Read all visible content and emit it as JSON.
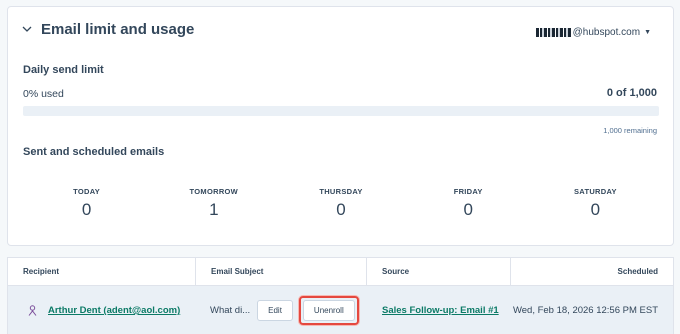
{
  "usage_card": {
    "title": "Email limit and usage",
    "account_suffix": "@hubspot.com",
    "daily_limit_title": "Daily send limit",
    "used_label": "0% used",
    "count_label": "0 of 1,000",
    "used_fraction": 0,
    "remaining_label": "1,000 remaining",
    "sent_title": "Sent and scheduled emails",
    "days": [
      {
        "label": "TODAY",
        "value": "0"
      },
      {
        "label": "TOMORROW",
        "value": "1"
      },
      {
        "label": "THURSDAY",
        "value": "0"
      },
      {
        "label": "FRIDAY",
        "value": "0"
      },
      {
        "label": "SATURDAY",
        "value": "0"
      }
    ]
  },
  "table": {
    "headers": {
      "recipient": "Recipient",
      "subject": "Email Subject",
      "source": "Source",
      "scheduled": "Scheduled"
    },
    "rows": [
      {
        "recipient": "Arthur Dent (adent@aol.com)",
        "subject": "What di...",
        "edit_label": "Edit",
        "unenroll_label": "Unenroll",
        "source": "Sales Follow-up: Email #1",
        "scheduled": "Wed, Feb 18, 2026 12:56 PM EST"
      }
    ]
  },
  "colors": {
    "accent_link": "#0b7a66",
    "highlight_border": "#e5483f",
    "row_background": "#eaf0f6"
  },
  "icons": [
    "chevron-down-icon",
    "caret-down-icon",
    "person-icon"
  ]
}
